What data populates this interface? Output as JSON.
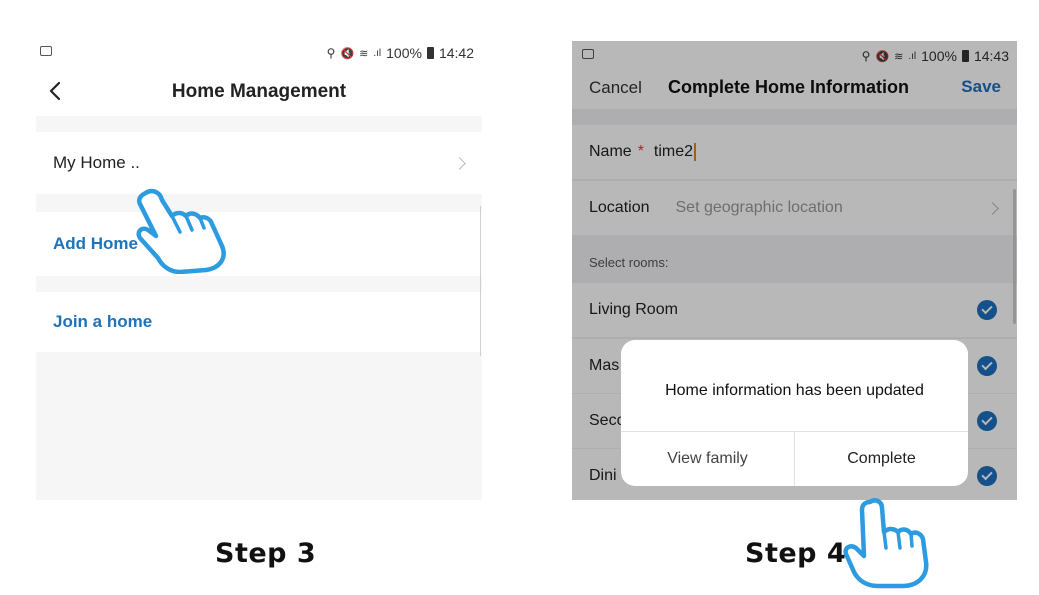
{
  "step3": {
    "status": {
      "battery": "100%",
      "time": "14:42"
    },
    "title": "Home Management",
    "home_item": "My Home ..",
    "add_home": "Add Home",
    "join_home": "Join a home",
    "caption": "Step 3"
  },
  "step4": {
    "status": {
      "battery": "100%",
      "time": "14:43"
    },
    "cancel": "Cancel",
    "title": "Complete Home Information",
    "save": "Save",
    "name_label": "Name",
    "required_mark": "*",
    "name_value": "time2",
    "location_label": "Location",
    "location_placeholder": "Set geographic location",
    "rooms_label": "Select rooms:",
    "rooms": [
      "Living Room",
      "Mas",
      "Seco",
      "Dini"
    ],
    "dialog": {
      "message": "Home information has been updated",
      "view_family": "View family",
      "complete": "Complete"
    },
    "caption": "Step 4"
  },
  "colors": {
    "accent": "#1c6fbe",
    "link": "#1d74b9",
    "required": "#e23b3b",
    "hand_stroke": "#2d9be0"
  },
  "icons": [
    "image-icon",
    "location-icon",
    "mute-icon",
    "wifi-icon",
    "signal-icon",
    "battery-icon",
    "back-arrow-icon",
    "chevron-right-icon",
    "checkmark-icon",
    "hand-pointer-icon"
  ]
}
